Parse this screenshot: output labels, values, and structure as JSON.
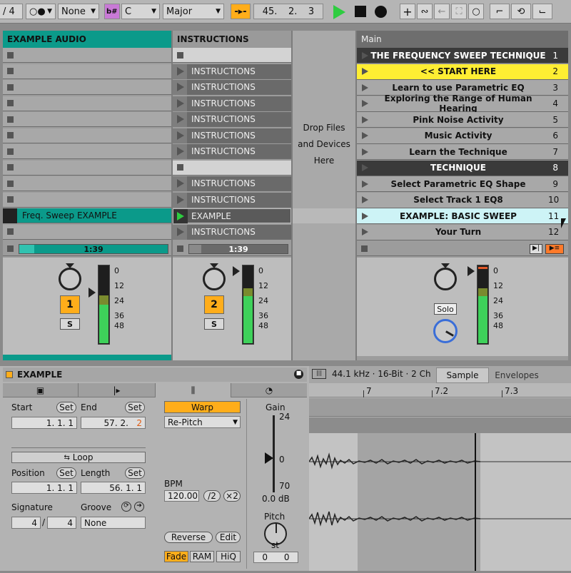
{
  "topbar": {
    "meter_label": "/ 4",
    "quantize": "None",
    "scale_icon": "b#",
    "key": "C",
    "scale": "Major",
    "position": [
      "45.",
      "2.",
      "3"
    ]
  },
  "session": {
    "tracks": [
      {
        "name": "EXAMPLE AUDIO",
        "color": "#0b9a8a",
        "number": "1",
        "solo": "S",
        "time": "1:39"
      },
      {
        "name": "INSTRUCTIONS",
        "number": "2",
        "solo": "S",
        "time": "1:39"
      }
    ],
    "example_audio_clip": "Freq. Sweep EXAMPLE",
    "instructions_clips": [
      "",
      "INSTRUCTIONS",
      "INSTRUCTIONS",
      "INSTRUCTIONS",
      "INSTRUCTIONS",
      "INSTRUCTIONS",
      "INSTRUCTIONS",
      "",
      "INSTRUCTIONS",
      "INSTRUCTIONS",
      "EXAMPLE",
      "INSTRUCTIONS"
    ],
    "drop_text": "Drop Files\nand Devices\nHere",
    "main_header": "Main",
    "solo_label": "Solo",
    "meter_scale": [
      "0",
      "12",
      "24",
      "36",
      "48"
    ],
    "scenes": [
      {
        "name": "THE FREQUENCY SWEEP TECHNIQUE",
        "num": "1",
        "style": "dark"
      },
      {
        "name": "<< START HERE",
        "num": "2",
        "style": "yellow"
      },
      {
        "name": "Learn to use Parametric EQ",
        "num": "3",
        "style": "normal"
      },
      {
        "name": "Exploring the Range of Human Hearing",
        "num": "4",
        "style": "normal"
      },
      {
        "name": "Pink Noise Activity",
        "num": "5",
        "style": "normal"
      },
      {
        "name": "Music Activity",
        "num": "6",
        "style": "normal"
      },
      {
        "name": "Learn the Technique",
        "num": "7",
        "style": "normal"
      },
      {
        "name": "TECHNIQUE",
        "num": "8",
        "style": "dark"
      },
      {
        "name": "Select Parametric EQ Shape",
        "num": "9",
        "style": "normal"
      },
      {
        "name": "Select Track 1  EQ8",
        "num": "10",
        "style": "normal"
      },
      {
        "name": "EXAMPLE: BASIC SWEEP",
        "num": "11",
        "style": "cyan"
      },
      {
        "name": "Your Turn",
        "num": "12",
        "style": "normal"
      }
    ]
  },
  "clip": {
    "title": "EXAMPLE",
    "sample_info": "44.1 kHz · 16-Bit · 2 Ch",
    "tabs": [
      "Sample",
      "Envelopes"
    ],
    "start_label": "Start",
    "end_label": "End",
    "set_label": "Set",
    "start_value": "1.   1.   1",
    "end_value": "57.   2.",
    "end_value_tail": "2",
    "loop_label": "Loop",
    "position_label": "Position",
    "length_label": "Length",
    "position_value": "1.   1.   1",
    "length_value": "56.   1.   1",
    "signature_label": "Signature",
    "groove_label": "Groove",
    "sig_num": "4",
    "sig_den": "4",
    "groove_value": "None",
    "warp_label": "Warp",
    "warp_mode": "Re-Pitch",
    "bpm_label": "BPM",
    "bpm_value": "120.00",
    "half_label": "/2",
    "double_label": "×2",
    "reverse_label": "Reverse",
    "edit_label": "Edit",
    "fade_label": "Fade",
    "ram_label": "RAM",
    "hiq_label": "HiQ",
    "gain_label": "Gain",
    "gain_top": "24",
    "gain_mid": "0",
    "gain_bottom": "70",
    "gain_value": "0.0 dB",
    "pitch_label": "Pitch",
    "pitch_unit": "st",
    "pitch_semitones": "0",
    "pitch_cents": "0",
    "ruler": [
      "7",
      "7.2",
      "7.3"
    ]
  }
}
